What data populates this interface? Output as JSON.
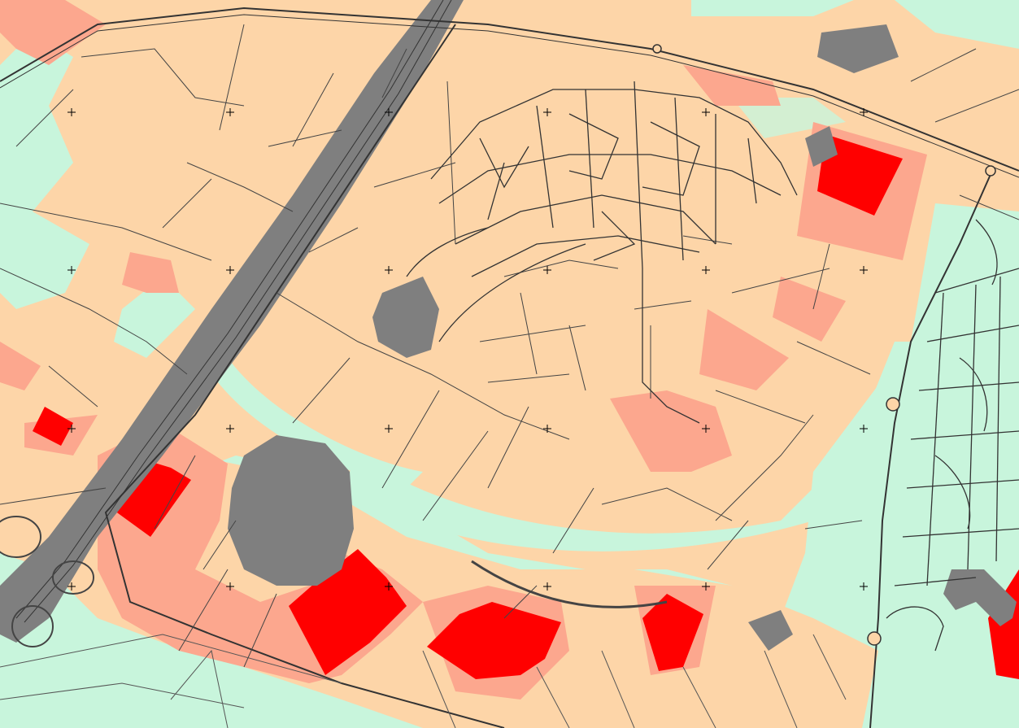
{
  "map": {
    "legend_colors": {
      "background_low": "#c8f5dc",
      "base_zone": "#fdd5a8",
      "medium_zone": "#fca78e",
      "high_zone": "#ff0000",
      "water_and_roads": "#7f7f7f",
      "lines": "#333333"
    },
    "grid_marker_icon": "plus-icon",
    "features": [
      "motorway",
      "railway",
      "town-centre",
      "lakes",
      "parcels",
      "hazard-zones"
    ]
  }
}
